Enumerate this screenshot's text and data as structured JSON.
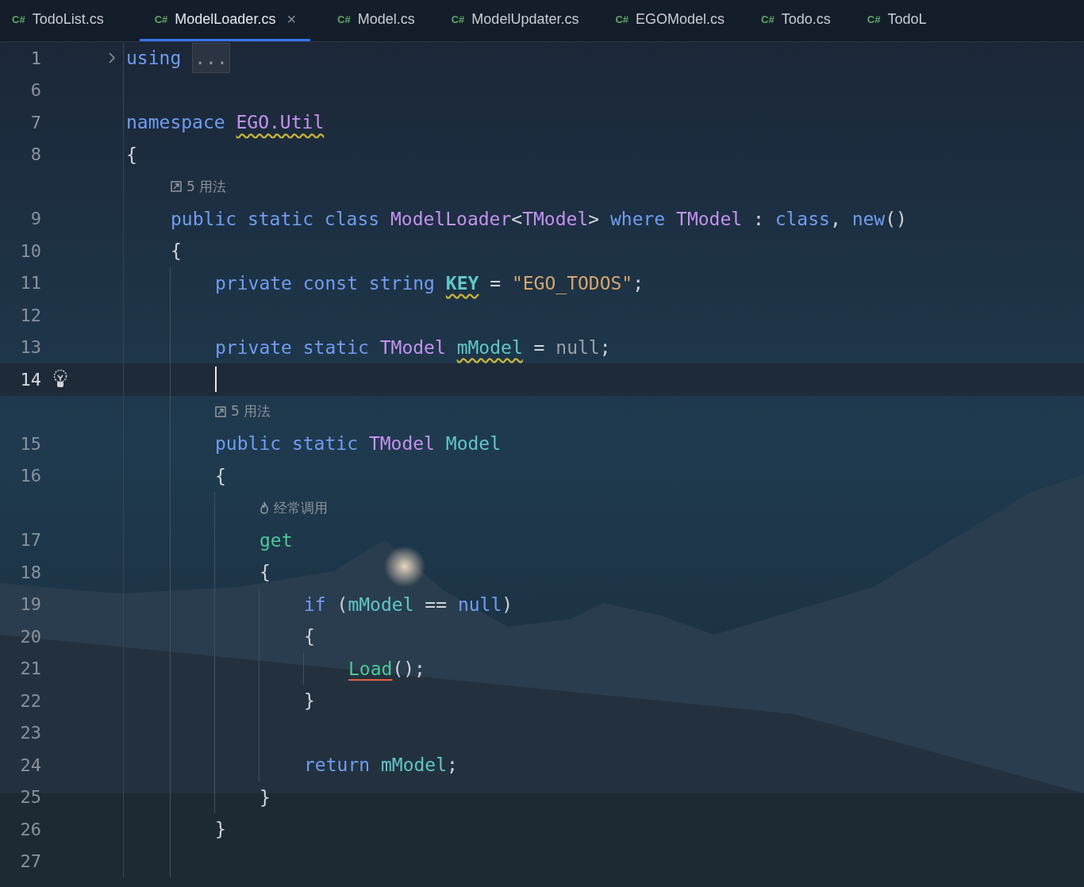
{
  "tabs": [
    {
      "icon": "C#",
      "label": "TodoList.cs",
      "selected": false
    },
    {
      "icon": "C#",
      "label": "ModelLoader.cs",
      "selected": true,
      "close": "×"
    },
    {
      "icon": "C#",
      "label": "Model.cs",
      "selected": false
    },
    {
      "icon": "C#",
      "label": "ModelUpdater.cs",
      "selected": false
    },
    {
      "icon": "C#",
      "label": "EGOModel.cs",
      "selected": false
    },
    {
      "icon": "C#",
      "label": "Todo.cs",
      "selected": false
    },
    {
      "icon": "C#",
      "label": "TodoL",
      "selected": false
    }
  ],
  "editor": {
    "rows": [
      {
        "kind": "code",
        "number": "1",
        "indent": "",
        "fold": true,
        "tokens": [
          {
            "text": "using",
            "kind": "keyword"
          },
          {
            "text": "...",
            "kind": "folded"
          }
        ]
      },
      {
        "kind": "code",
        "number": "6",
        "indent": "",
        "tokens": []
      },
      {
        "kind": "code",
        "number": "7",
        "indent": "",
        "tokens": [
          {
            "text": "namespace ",
            "kind": "keyword"
          },
          {
            "text": "EGO.Util",
            "kind": "type",
            "warning": true
          }
        ]
      },
      {
        "kind": "code",
        "number": "8",
        "indent": "",
        "tokens": [
          {
            "text": "{",
            "kind": "plain"
          }
        ]
      },
      {
        "kind": "usages",
        "indent": "    ",
        "text": "5 用法"
      },
      {
        "kind": "code",
        "number": "9",
        "indent": "    ",
        "tokens": [
          {
            "text": "public static class ",
            "kind": "keyword"
          },
          {
            "text": "ModelLoader",
            "kind": "type"
          },
          {
            "text": "<",
            "kind": "plain"
          },
          {
            "text": "TModel",
            "kind": "type"
          },
          {
            "text": "> ",
            "kind": "plain"
          },
          {
            "text": "where ",
            "kind": "keyword"
          },
          {
            "text": "TModel",
            "kind": "type"
          },
          {
            "text": " : ",
            "kind": "plain"
          },
          {
            "text": "class",
            "kind": "keyword"
          },
          {
            "text": ", ",
            "kind": "plain"
          },
          {
            "text": "new",
            "kind": "keyword"
          },
          {
            "text": "()",
            "kind": "plain"
          }
        ]
      },
      {
        "kind": "code",
        "number": "10",
        "indent": "    ",
        "tokens": [
          {
            "text": "{",
            "kind": "plain"
          }
        ]
      },
      {
        "kind": "code",
        "number": "11",
        "indent": "        ",
        "tokens": [
          {
            "text": "private const string ",
            "kind": "keyword"
          },
          {
            "text": "KEY",
            "kind": "constant",
            "warning": true
          },
          {
            "text": " = ",
            "kind": "plain"
          },
          {
            "text": "\"EGO_TODOS\"",
            "kind": "string"
          },
          {
            "text": ";",
            "kind": "plain"
          }
        ]
      },
      {
        "kind": "code",
        "number": "12",
        "indent": "        ",
        "tokens": []
      },
      {
        "kind": "code",
        "number": "13",
        "indent": "        ",
        "tokens": [
          {
            "text": "private static ",
            "kind": "keyword"
          },
          {
            "text": "TModel ",
            "kind": "type"
          },
          {
            "text": "mModel",
            "kind": "field",
            "warning": true
          },
          {
            "text": " = ",
            "kind": "plain"
          },
          {
            "text": "null",
            "kind": "muted"
          },
          {
            "text": ";",
            "kind": "plain"
          }
        ]
      },
      {
        "kind": "code",
        "number": "14",
        "indent": "        ",
        "current": true,
        "bulb": true,
        "tokens": []
      },
      {
        "kind": "usages",
        "indent": "        ",
        "text": "5 用法"
      },
      {
        "kind": "code",
        "number": "15",
        "indent": "        ",
        "tokens": [
          {
            "text": "public static ",
            "kind": "keyword"
          },
          {
            "text": "TModel ",
            "kind": "type"
          },
          {
            "text": "Model",
            "kind": "field"
          }
        ]
      },
      {
        "kind": "code",
        "number": "16",
        "indent": "        ",
        "tokens": [
          {
            "text": "{",
            "kind": "plain"
          }
        ]
      },
      {
        "kind": "frequent",
        "indent": "            ",
        "text": "经常调用"
      },
      {
        "kind": "code",
        "number": "17",
        "indent": "            ",
        "tokens": [
          {
            "text": "get",
            "kind": "accessor"
          }
        ]
      },
      {
        "kind": "code",
        "number": "18",
        "indent": "            ",
        "tokens": [
          {
            "text": "{",
            "kind": "plain"
          }
        ]
      },
      {
        "kind": "code",
        "number": "19",
        "indent": "                ",
        "tokens": [
          {
            "text": "if ",
            "kind": "keyword"
          },
          {
            "text": "(",
            "kind": "plain"
          },
          {
            "text": "mModel",
            "kind": "field"
          },
          {
            "text": " == ",
            "kind": "plain"
          },
          {
            "text": "null",
            "kind": "keyword"
          },
          {
            "text": ")",
            "kind": "plain"
          }
        ]
      },
      {
        "kind": "code",
        "number": "20",
        "indent": "                ",
        "tokens": [
          {
            "text": "{",
            "kind": "plain"
          }
        ]
      },
      {
        "kind": "code",
        "number": "21",
        "indent": "                    ",
        "tokens": [
          {
            "text": "Load",
            "kind": "method",
            "error": true
          },
          {
            "text": "();",
            "kind": "plain"
          }
        ]
      },
      {
        "kind": "code",
        "number": "22",
        "indent": "                ",
        "tokens": [
          {
            "text": "}",
            "kind": "plain"
          }
        ]
      },
      {
        "kind": "code",
        "number": "23",
        "indent": "                ",
        "tokens": []
      },
      {
        "kind": "code",
        "number": "24",
        "indent": "                ",
        "tokens": [
          {
            "text": "return ",
            "kind": "keyword"
          },
          {
            "text": "mModel",
            "kind": "field"
          },
          {
            "text": ";",
            "kind": "plain"
          }
        ]
      },
      {
        "kind": "code",
        "number": "25",
        "indent": "            ",
        "tokens": [
          {
            "text": "}",
            "kind": "plain"
          }
        ]
      },
      {
        "kind": "code",
        "number": "26",
        "indent": "        ",
        "tokens": [
          {
            "text": "}",
            "kind": "plain"
          }
        ]
      },
      {
        "kind": "code",
        "number": "27",
        "indent": "        ",
        "tokens": []
      }
    ]
  }
}
